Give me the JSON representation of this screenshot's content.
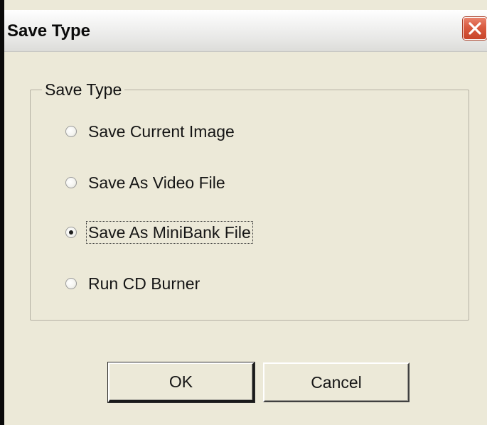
{
  "window": {
    "title": "Save Type",
    "close_icon": "close-x-icon",
    "close_color": "#d95a3f"
  },
  "group": {
    "legend": "Save Type"
  },
  "options": [
    {
      "label": "Save Current Image",
      "checked": false
    },
    {
      "label": "Save As Video File",
      "checked": false
    },
    {
      "label": "Save As MiniBank File",
      "checked": true
    },
    {
      "label": "Run CD Burner",
      "checked": false
    }
  ],
  "buttons": {
    "ok_label": "OK",
    "cancel_label": "Cancel"
  }
}
